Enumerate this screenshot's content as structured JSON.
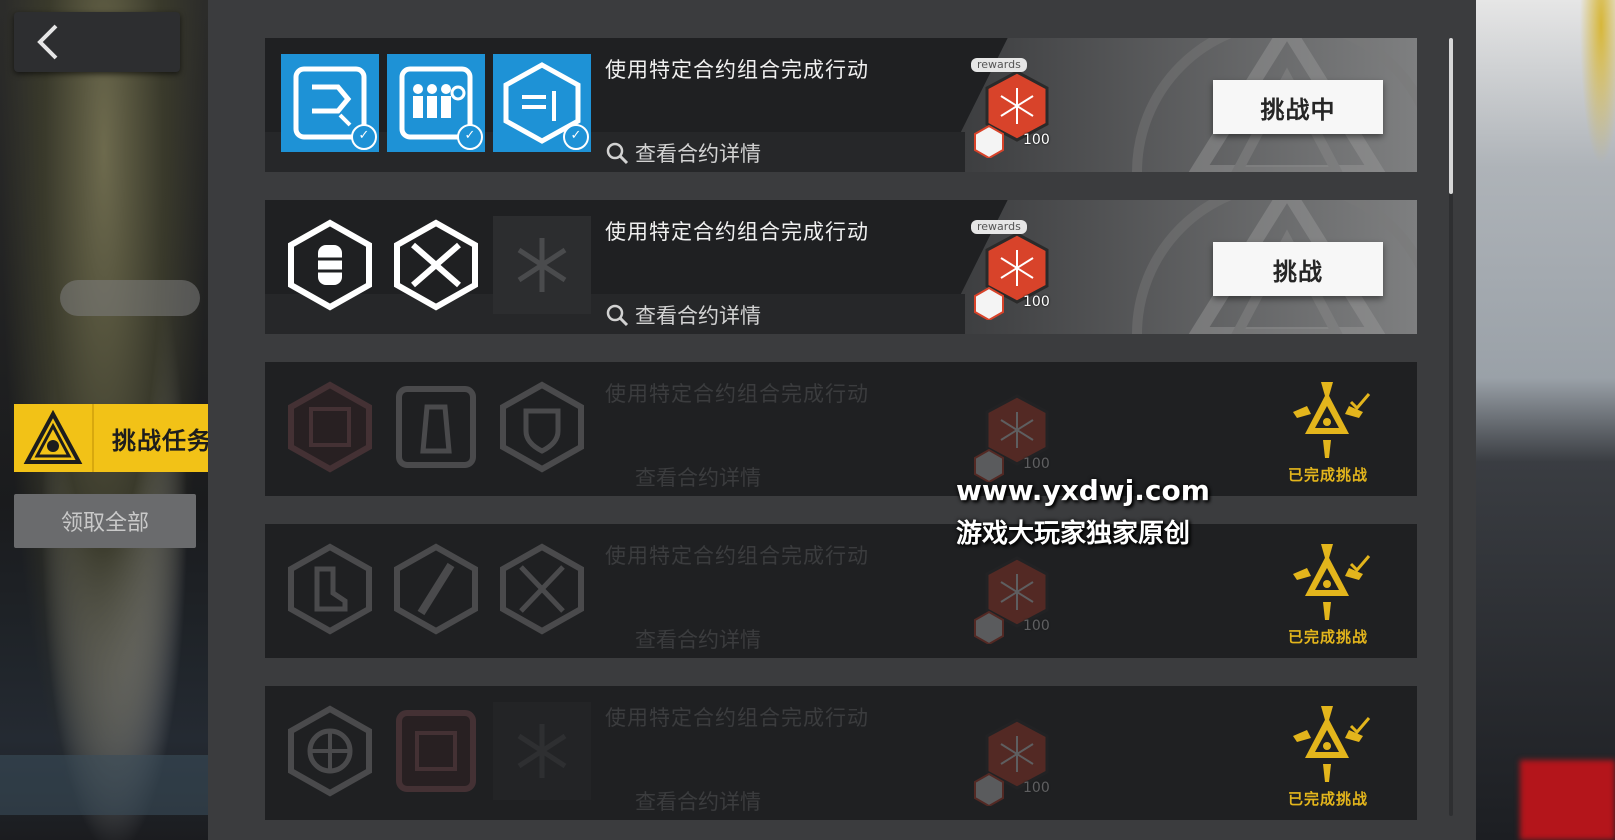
{
  "sidebar": {
    "back_icon": "chevron-left-icon",
    "tab_label": "挑战任务",
    "claim_all_label": "领取全部"
  },
  "reward_tag": "rewards",
  "cards": [
    {
      "title": "使用特定合约组合完成行动",
      "detail_label": "查看合约详情",
      "reward_count": "100",
      "action_label": "挑战中",
      "status": "in-progress",
      "icons": [
        "contract-arrow-icon",
        "contract-squad-icon",
        "contract-deploy-icon"
      ],
      "icons_checked": [
        true,
        true,
        true
      ]
    },
    {
      "title": "使用特定合约组合完成行动",
      "detail_label": "查看合约详情",
      "reward_count": "100",
      "action_label": "挑战",
      "status": "available",
      "icons": [
        "contract-grenade-icon",
        "contract-cross-icon",
        "contingency-contract-icon"
      ]
    },
    {
      "title": "使用特定合约组合完成行动",
      "detail_label": "查看合约详情",
      "reward_count": "100",
      "done_label": "已完成挑战",
      "status": "completed",
      "icons": [
        "contract-conflict-icon",
        "contract-tower-icon",
        "contract-shield-icon"
      ]
    },
    {
      "title": "使用特定合约组合完成行动",
      "detail_label": "查看合约详情",
      "reward_count": "100",
      "done_label": "已完成挑战",
      "status": "completed",
      "icons": [
        "contract-boot-icon",
        "contract-blade-icon",
        "contract-swords-icon"
      ]
    },
    {
      "title": "使用特定合约组合完成行动",
      "detail_label": "查看合约详情",
      "reward_count": "100",
      "done_label": "已完成挑战",
      "status": "completed",
      "icons": [
        "contract-target-icon",
        "contract-conflict-icon",
        "contingency-contract-icon"
      ]
    }
  ],
  "watermark": {
    "line1": "www.yxdwj.com",
    "line2": "游戏大玩家独家原创"
  },
  "colors": {
    "accent_yellow": "#f2c217",
    "accent_blue": "#1e92d6",
    "reward_red": "#d8432a",
    "done_gold": "#e3b51c"
  }
}
